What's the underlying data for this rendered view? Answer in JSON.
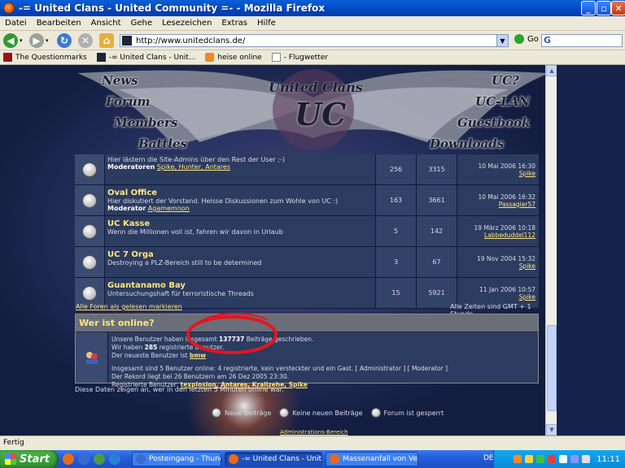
{
  "window": {
    "title": "-= United Clans - United Community =- - Mozilla Firefox"
  },
  "menu": [
    "Datei",
    "Bearbeiten",
    "Ansicht",
    "Gehe",
    "Lesezeichen",
    "Extras",
    "Hilfe"
  ],
  "nav": {
    "url": "http://www.unitedclans.de/",
    "go_label": "Go"
  },
  "bookmarks": [
    "The Questionmarks",
    "-= United Clans - Unit...",
    "heise online",
    "- Flugwetter"
  ],
  "site": {
    "logo_line1": "United Clans",
    "logo_line2": "UC",
    "nav_left": [
      "News",
      "Forum",
      "Members",
      "Battles"
    ],
    "nav_right": [
      "UC?",
      "UC-LAN",
      "Guestbook",
      "Downloads"
    ]
  },
  "forums": [
    {
      "title": "",
      "desc": "Hier lästern die Site-Admins über den Rest der User ;-)",
      "mod_label": "Moderatoren",
      "mods": "Spike, Hunter, Antares",
      "topics": "256",
      "posts": "3315",
      "last_date": "10 Mai 2006 16:30",
      "last_user": "Spike"
    },
    {
      "title": "Oval Office",
      "desc": "Hier diskutiert der Vorstand. Heisse Diskussionen zum Wohle von UC :)",
      "mod_label": "Moderator",
      "mods": "Agamemnon",
      "topics": "163",
      "posts": "3661",
      "last_date": "10 Mai 2006 16:32",
      "last_user": "Passagier57"
    },
    {
      "title": "UC Kasse",
      "desc": "Wenn die Millionen voll ist, fahren wir davon in Urlaub",
      "mod_label": "",
      "mods": "",
      "topics": "5",
      "posts": "142",
      "last_date": "19 März 2006 10:18",
      "last_user": "Labbeduddel112"
    },
    {
      "title": "UC 7 Orga",
      "desc": "Destroying a PLZ-Bereich still to be determined",
      "mod_label": "",
      "mods": "",
      "topics": "3",
      "posts": "67",
      "last_date": "19 Nov 2004 15:32",
      "last_user": "Spike"
    },
    {
      "title": "Guantanamo Bay",
      "desc": "Untersuchungshaft für terroristische Threads",
      "mod_label": "",
      "mods": "",
      "topics": "15",
      "posts": "5921",
      "last_date": "11 Jan 2006 10:57",
      "last_user": "Spike"
    }
  ],
  "below_table": {
    "mark_read": "Alle Foren als gelesen markieren",
    "timezone": "Alle Zeiten sind GMT + 1 Stunde"
  },
  "online": {
    "heading": "Wer ist online?",
    "line1_a": "Unsere Benutzer haben insgesamt",
    "posts_total": "137737",
    "line1_b": "Beiträge geschrieben.",
    "line2_a": "Wir haben",
    "users_total": "285",
    "line2_b": "registrierte Benutzer.",
    "line3_a": "Der neueste Benutzer ist",
    "newest_user": "bmw",
    "line4": "Insgesamt sind 5 Benutzer online: 4 registrierte, kein versteckter und ein Gast.   [ Administrator ]   [ Moderator ]",
    "line5": "Der Rekord liegt bei 26 Benutzern am 26 Dez 2005 23:30.",
    "line6_label": "Registrierte Benutzer:",
    "online_users": "texplosion, Antares, Krallzehe, Spike",
    "footnote": "Diese Daten zeigen an, wer in den letzten 5 Minuten online war."
  },
  "legend": [
    "Neue Beiträge",
    "Keine neuen Beiträge",
    "Forum ist gesperrt"
  ],
  "admin_link": "Administrations-Bereich",
  "status": "Fertig",
  "taskbar": {
    "start": "Start",
    "tasks": [
      "Posteingang - Thund...",
      "-= United Clans - Unit...",
      "Massenanfall von Verl..."
    ],
    "lang": "DE",
    "clock": "11:11"
  },
  "colors": {
    "accent": "#245edb",
    "forum_title": "#ffe680",
    "content_bg": "#16234a",
    "annotation_circle": "#e8141e"
  }
}
